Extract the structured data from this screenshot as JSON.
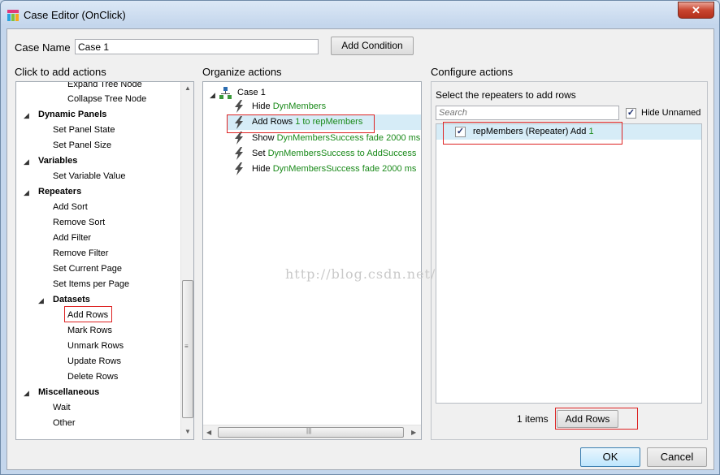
{
  "window": {
    "title": "Case Editor (OnClick)",
    "close_glyph": "✕"
  },
  "case_name": {
    "label": "Case Name",
    "value": "Case 1",
    "add_condition": "Add Condition"
  },
  "left_panel": {
    "heading": "Click to add actions",
    "items": [
      {
        "label": "Expand Tree Node"
      },
      {
        "label": "Collapse Tree Node"
      },
      {
        "label": "Dynamic Panels"
      },
      {
        "label": "Set Panel State"
      },
      {
        "label": "Set Panel Size"
      },
      {
        "label": "Variables"
      },
      {
        "label": "Set Variable Value"
      },
      {
        "label": "Repeaters"
      },
      {
        "label": "Add Sort"
      },
      {
        "label": "Remove Sort"
      },
      {
        "label": "Add Filter"
      },
      {
        "label": "Remove Filter"
      },
      {
        "label": "Set Current Page"
      },
      {
        "label": "Set Items per Page"
      },
      {
        "label": "Datasets"
      },
      {
        "label": "Add Rows"
      },
      {
        "label": "Mark Rows"
      },
      {
        "label": "Unmark Rows"
      },
      {
        "label": "Update Rows"
      },
      {
        "label": "Delete Rows"
      },
      {
        "label": "Miscellaneous"
      },
      {
        "label": "Wait"
      },
      {
        "label": "Other"
      }
    ]
  },
  "middle_panel": {
    "heading": "Organize actions",
    "case_label": "Case 1",
    "actions": [
      {
        "verb": "Hide",
        "detail": "DynMembers"
      },
      {
        "verb": "Add Rows",
        "detail": "1 to repMembers"
      },
      {
        "verb": "Show",
        "detail": "DynMembersSuccess fade 2000 ms"
      },
      {
        "verb": "Set",
        "detail": "DynMembersSuccess to AddSuccess"
      },
      {
        "verb": "Hide",
        "detail": "DynMembersSuccess fade 2000 ms"
      }
    ]
  },
  "right_panel": {
    "heading": "Configure actions",
    "subheading": "Select the repeaters to add rows",
    "search_placeholder": "Search",
    "hide_unnamed": "Hide Unnamed",
    "repeater": {
      "label": "repMembers (Repeater) Add ",
      "value": "1"
    },
    "items_count": "1 items",
    "add_rows_button": "Add Rows"
  },
  "footer": {
    "ok": "OK",
    "cancel": "Cancel"
  },
  "watermark": "http://blog.csdn.net/",
  "colors": {
    "accent_green": "#1a8a1a",
    "highlight_box": "#dd2222",
    "selection": "#d6ecf7"
  }
}
